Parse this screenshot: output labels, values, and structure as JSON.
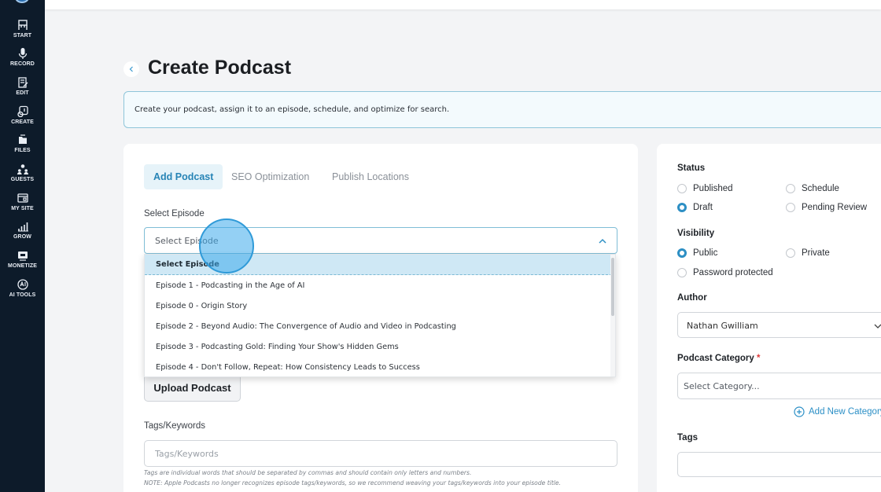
{
  "sidebar": {
    "items": [
      {
        "label": "START",
        "icon": "start-icon"
      },
      {
        "label": "RECORD",
        "icon": "microphone-icon"
      },
      {
        "label": "EDIT",
        "icon": "edit-icon"
      },
      {
        "label": "CREATE",
        "icon": "create-icon"
      },
      {
        "label": "FILES",
        "icon": "files-icon"
      },
      {
        "label": "GUESTS",
        "icon": "guests-icon"
      },
      {
        "label": "MY SITE",
        "icon": "site-icon"
      },
      {
        "label": "GROW",
        "icon": "grow-icon"
      },
      {
        "label": "MONETIZE",
        "icon": "monetize-icon"
      },
      {
        "label": "AI TOOLS",
        "icon": "ai-tools-icon"
      }
    ]
  },
  "header": {
    "title": "Create Podcast",
    "info": "Create your podcast, assign it to an episode, schedule, and optimize for search."
  },
  "tabs": [
    {
      "label": "Add Podcast",
      "active": true
    },
    {
      "label": "SEO Optimization",
      "active": false
    },
    {
      "label": "Publish Locations",
      "active": false
    }
  ],
  "episode": {
    "label": "Select Episode",
    "value": "Select Episode",
    "options": [
      "Select Episode",
      "Episode 1 - Podcasting in the Age of AI",
      "Episode 0 - Origin Story",
      "Episode 2 - Beyond Audio: The Convergence of Audio and Video in Podcasting",
      "Episode 3 - Podcasting Gold: Finding Your Show's Hidden Gems",
      "Episode 4 - Don't Follow, Repeat: How Consistency Leads to Success"
    ]
  },
  "upload": {
    "label": "Upload Podcast"
  },
  "tags": {
    "label": "Tags/Keywords",
    "placeholder": "Tags/Keywords",
    "help1": "Tags are individual words that should be separated by commas and should contain only letters and numbers.",
    "help2": "NOTE: Apple Podcasts no longer recognizes episode tags/keywords, so we recommend weaving your tags/keywords into your episode title."
  },
  "side": {
    "status": {
      "label": "Status",
      "options": [
        {
          "label": "Published",
          "checked": false
        },
        {
          "label": "Schedule",
          "checked": false
        },
        {
          "label": "Draft",
          "checked": true
        },
        {
          "label": "Pending Review",
          "checked": false
        }
      ]
    },
    "visibility": {
      "label": "Visibility",
      "options": [
        {
          "label": "Public",
          "checked": true
        },
        {
          "label": "Private",
          "checked": false
        },
        {
          "label": "Password protected",
          "checked": false
        }
      ]
    },
    "author": {
      "label": "Author",
      "value": "Nathan Gwilliam"
    },
    "category": {
      "label": "Podcast Category",
      "required": "*",
      "placeholder": "Select Category..."
    },
    "add_category": "Add New Category",
    "tags_label": "Tags"
  },
  "colors": {
    "sidebar_bg": "#0d1b2a",
    "accent": "#2d8fc4",
    "active_tab_bg": "#e6f3f9",
    "selected_option_bg": "#cfe8f5"
  }
}
